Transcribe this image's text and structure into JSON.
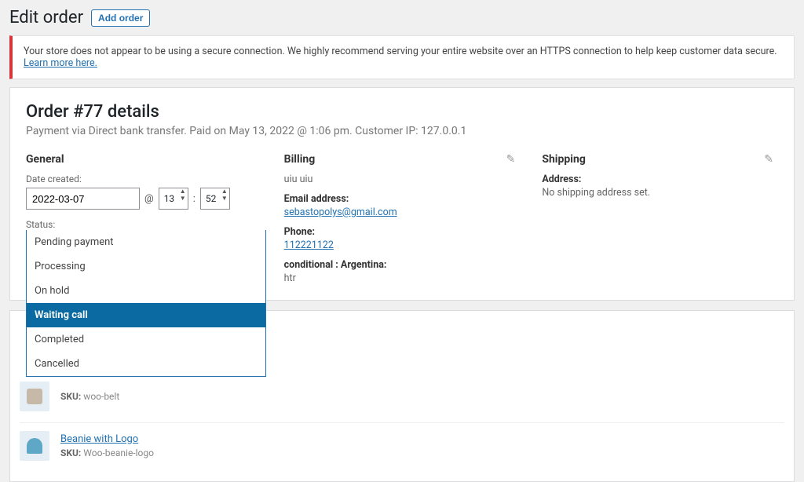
{
  "header": {
    "title": "Edit order",
    "add_label": "Add order"
  },
  "notice": {
    "text": "Your store does not appear to be using a secure connection. We highly recommend serving your entire website over an HTTPS connection to help keep customer data secure. ",
    "link": "Learn more here."
  },
  "order": {
    "title": "Order #77 details",
    "subline": "Payment via Direct bank transfer. Paid on May 13, 2022 @ 1:06 pm. Customer IP: 127.0.0.1"
  },
  "general": {
    "heading": "General",
    "date_label": "Date created:",
    "date_value": "2022-03-07",
    "at_symbol": "@",
    "hour_value": "13",
    "minute_value": "52",
    "colon": ":",
    "status_label": "Status:",
    "status_selected": "Waiting call",
    "options": [
      {
        "label": "Pending payment"
      },
      {
        "label": "Processing"
      },
      {
        "label": "On hold"
      },
      {
        "label": "Waiting call"
      },
      {
        "label": "Completed"
      },
      {
        "label": "Cancelled"
      }
    ]
  },
  "billing": {
    "heading": "Billing",
    "name": "uiu uiu",
    "email_label": "Email address:",
    "email": "sebastopolys@gmail.com",
    "phone_label": "Phone:",
    "phone": "112221122",
    "cond_label": "conditional : Argentina:",
    "cond_value": "htr"
  },
  "shipping": {
    "heading": "Shipping",
    "addr_label": "Address:",
    "addr_value": "No shipping address set."
  },
  "items": [
    {
      "sku_label": "SKU:",
      "sku": "woo-belt",
      "name": "",
      "color": "#9b8c7b"
    },
    {
      "sku_label": "SKU:",
      "sku": "Woo-beanie-logo",
      "name": "Beanie with Logo",
      "color": "#5fa7c6"
    }
  ]
}
